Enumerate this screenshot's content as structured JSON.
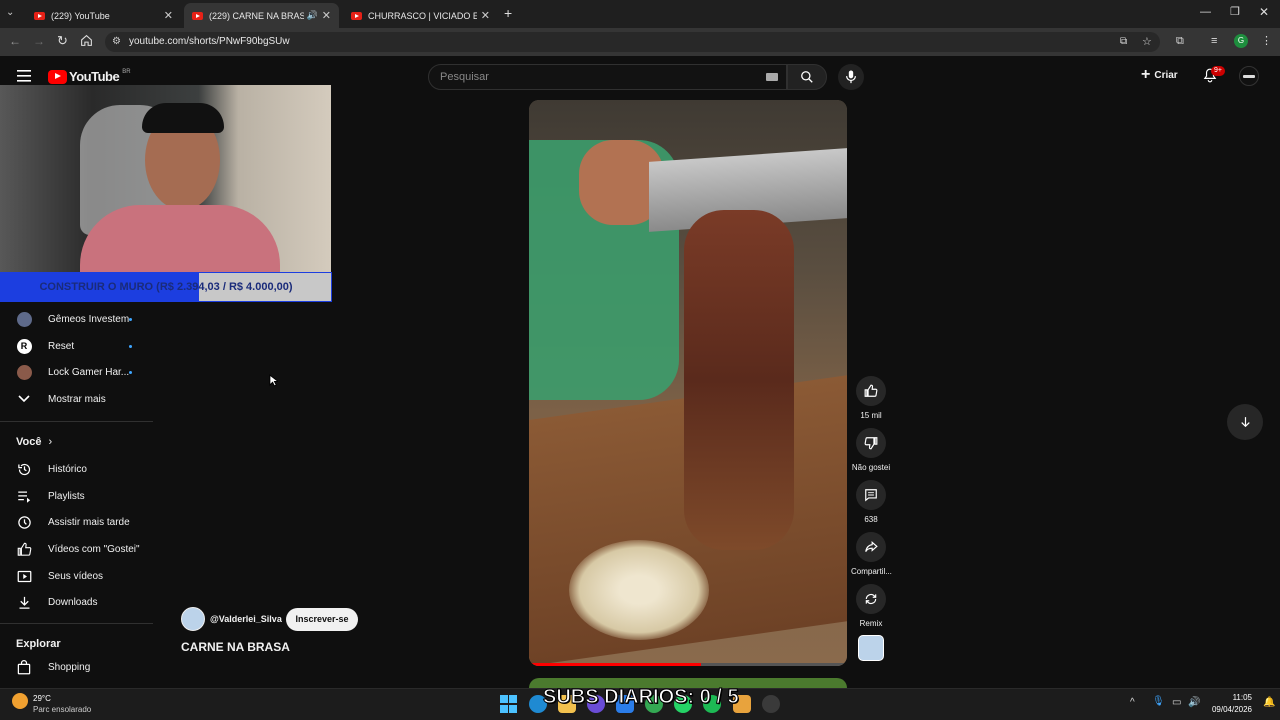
{
  "browser": {
    "tabs": [
      {
        "title": "(229) YouTube",
        "active": false
      },
      {
        "title": "(229) CARNE NA BRASA - Y",
        "active": true
      },
      {
        "title": "CHURRASCO | VICIADO EM CH",
        "active": false
      }
    ],
    "new_tab": "+",
    "url": "youtube.com/shorts/PNwF90bgSUw"
  },
  "youtube": {
    "logo": "YouTube",
    "country": "BR",
    "search_placeholder": "Pesquisar",
    "create_label": "Criar",
    "notif_badge": "9+"
  },
  "stream_overlay": {
    "goal_text": "CONSTRUIR O MURO (R$ 2.394,03 / R$ 4.000,00)",
    "goal_progress": 0.5985,
    "subs_text": "SUBS DIARIOS: 0 / 5"
  },
  "sidebar": {
    "subscriptions": [
      {
        "name": "Gêmeos Investem",
        "icon": "avatar-twins"
      },
      {
        "name": "Reset",
        "icon": "avatar-reset"
      },
      {
        "name": "Lock Gamer Har...",
        "icon": "avatar-lock"
      }
    ],
    "show_more": "Mostrar mais",
    "you_title": "Você",
    "you_items": [
      {
        "label": "Histórico",
        "icon": "history-icon"
      },
      {
        "label": "Playlists",
        "icon": "playlist-icon"
      },
      {
        "label": "Assistir mais tarde",
        "icon": "clock-icon"
      },
      {
        "label": "Vídeos com \"Gostei\"",
        "icon": "like-icon"
      },
      {
        "label": "Seus vídeos",
        "icon": "video-icon"
      },
      {
        "label": "Downloads",
        "icon": "download-icon"
      }
    ],
    "explore_title": "Explorar",
    "explore_items": [
      {
        "label": "Shopping",
        "icon": "bag-icon"
      }
    ]
  },
  "short": {
    "channel": "@Valderlei_Silva",
    "subscribe": "Inscrever-se",
    "title": "CARNE NA BRASA",
    "progress": 0.54,
    "actions": {
      "likes": "15 mil",
      "dislike": "Não gostei",
      "comments": "638",
      "share": "Compartil...",
      "remix": "Remix"
    }
  },
  "taskbar": {
    "weather_temp": "29°C",
    "weather_desc": "Parc ensolarado",
    "time": "11:05",
    "date": "09/04/2026"
  },
  "colors": {
    "yt_red": "#ff0000",
    "goal_blue": "#1c3ee0",
    "link_blue": "#3ea6ff"
  }
}
